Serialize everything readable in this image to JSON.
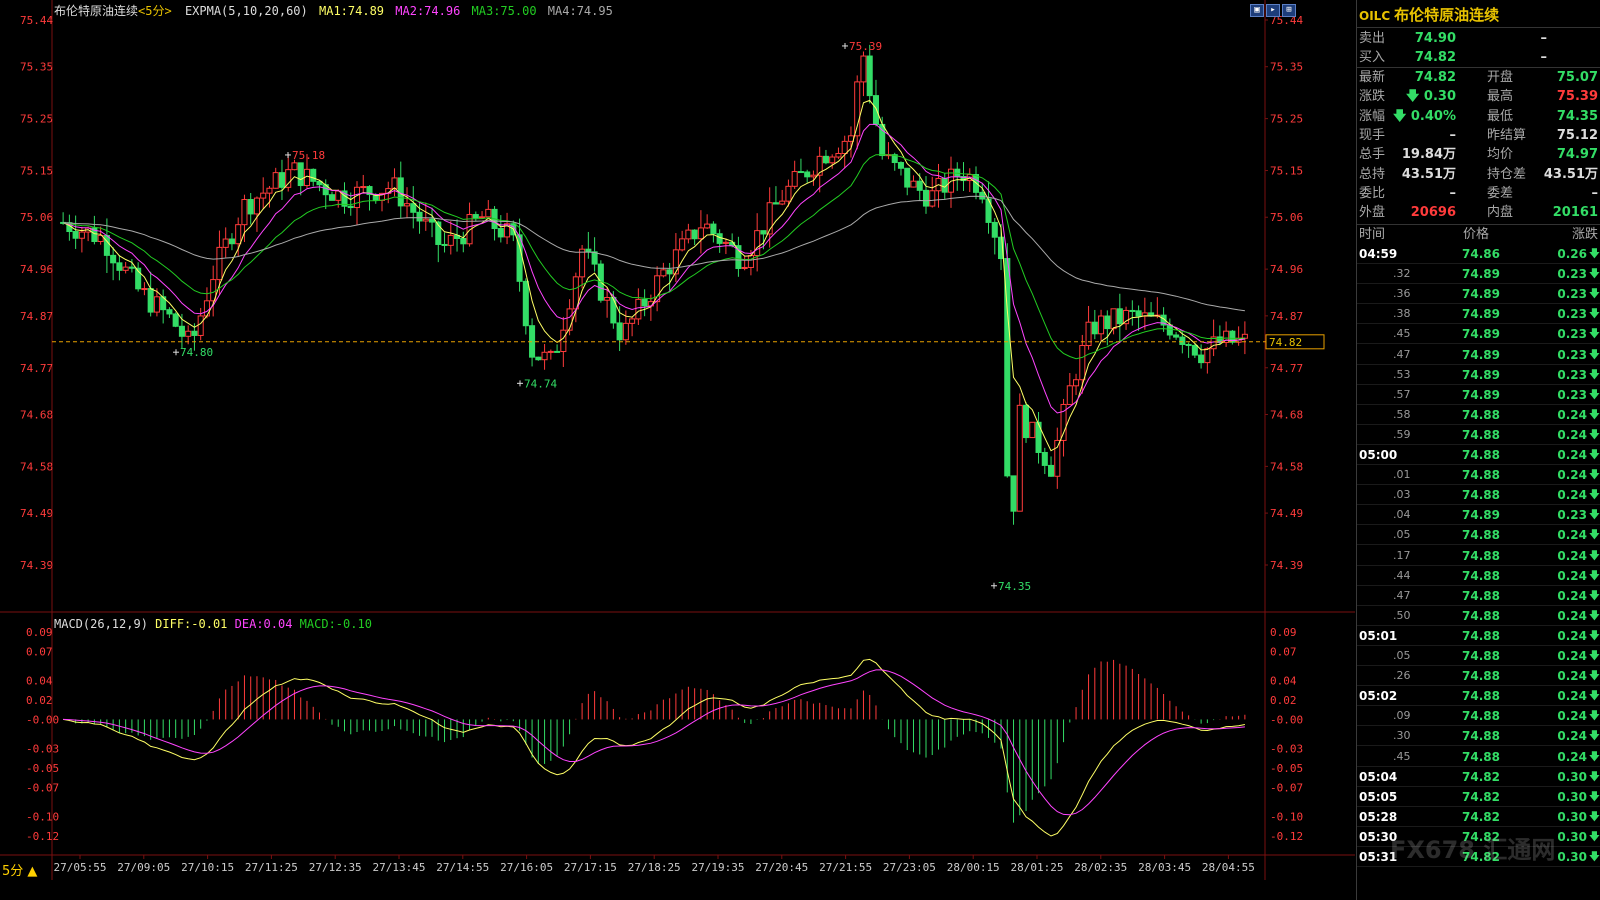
{
  "chart_header": {
    "instrument": "布伦特原油连续",
    "period_tag": "<5分>",
    "indicator": "EXPMA(5,10,20,60)",
    "ma1": "MA1:74.89",
    "ma2": "MA2:74.96",
    "ma3": "MA3:75.00",
    "ma4": "MA4:74.95"
  },
  "macd_header": {
    "name": "MACD(26,12,9)",
    "diff": "DIFF:-0.01",
    "dea": "DEA:0.04",
    "macd": "MACD:-0.10"
  },
  "price_axis_left": [
    "75.44",
    "75.35",
    "75.25",
    "75.15",
    "75.06",
    "74.96",
    "74.87",
    "74.77",
    "74.68",
    "74.58",
    "74.49",
    "74.39"
  ],
  "price_axis_right": [
    "75.44",
    "75.35",
    "75.25",
    "75.15",
    "75.06",
    "74.96",
    "74.87",
    "74.77",
    "74.68",
    "74.58",
    "74.49",
    "74.39"
  ],
  "macd_axis": [
    "0.09",
    "0.07",
    "0.04",
    "0.02",
    "-0.00",
    "-0.03",
    "-0.05",
    "-0.07",
    "-0.10",
    "-0.12"
  ],
  "time_axis": [
    "27/05:55",
    "27/09:05",
    "27/10:15",
    "27/11:25",
    "27/12:35",
    "27/13:45",
    "27/14:55",
    "27/16:05",
    "27/17:15",
    "27/18:25",
    "27/19:35",
    "27/20:45",
    "27/21:55",
    "27/23:05",
    "28/00:15",
    "28/01:25",
    "28/02:35",
    "28/03:45",
    "28/04:55"
  ],
  "annotations": {
    "high": "75.39",
    "peak1": "75.18",
    "low1": "74.80",
    "low2": "74.74",
    "low3": "74.35",
    "last_price": "74.82"
  },
  "period_button": "5分 ▲",
  "toolbar": [
    "▣",
    "▸",
    "⊞"
  ],
  "quote_panel": {
    "code": "OILC",
    "name": "布伦特原油连续",
    "sell_label": "卖出",
    "sell_value": "74.90",
    "sell_vol": "–",
    "buy_label": "买入",
    "buy_value": "74.82",
    "buy_vol": "–",
    "rows": [
      {
        "l1": "最新",
        "v1": "74.82",
        "c1": "#33dd66",
        "l2": "开盘",
        "v2": "75.07",
        "c2": "#33dd66"
      },
      {
        "l1": "涨跌",
        "v1": "🡇 0.30",
        "c1": "#33dd66",
        "l2": "最高",
        "v2": "75.39",
        "c2": "#ff3b3b"
      },
      {
        "l1": "涨幅",
        "v1": "🡇 0.40%",
        "c1": "#33dd66",
        "l2": "最低",
        "v2": "74.35",
        "c2": "#33dd66"
      },
      {
        "l1": "现手",
        "v1": "–",
        "c1": "#dddddd",
        "l2": "昨结算",
        "v2": "75.12",
        "c2": "#dddddd"
      },
      {
        "l1": "总手",
        "v1": "19.84万",
        "c1": "#dddddd",
        "l2": "均价",
        "v2": "74.97",
        "c2": "#33dd66"
      },
      {
        "l1": "总持",
        "v1": "43.51万",
        "c1": "#dddddd",
        "l2": "持仓差",
        "v2": "43.51万",
        "c2": "#dddddd"
      },
      {
        "l1": "委比",
        "v1": "–",
        "c1": "#dddddd",
        "l2": "委差",
        "v2": "–",
        "c2": "#dddddd"
      },
      {
        "l1": "外盘",
        "v1": "20696",
        "c1": "#ff3b3b",
        "l2": "内盘",
        "v2": "20161",
        "c2": "#33dd66"
      }
    ],
    "tick_header": {
      "time": "时间",
      "price": "价格",
      "change": "涨跌"
    },
    "ticks": [
      {
        "t": "04:59",
        "big": true,
        "p": "74.86",
        "c": "0.26"
      },
      {
        "t": ".32",
        "big": false,
        "p": "74.89",
        "c": "0.23"
      },
      {
        "t": ".36",
        "big": false,
        "p": "74.89",
        "c": "0.23"
      },
      {
        "t": ".38",
        "big": false,
        "p": "74.89",
        "c": "0.23"
      },
      {
        "t": ".45",
        "big": false,
        "p": "74.89",
        "c": "0.23"
      },
      {
        "t": ".47",
        "big": false,
        "p": "74.89",
        "c": "0.23"
      },
      {
        "t": ".53",
        "big": false,
        "p": "74.89",
        "c": "0.23"
      },
      {
        "t": ".57",
        "big": false,
        "p": "74.89",
        "c": "0.23"
      },
      {
        "t": ".58",
        "big": false,
        "p": "74.88",
        "c": "0.24"
      },
      {
        "t": ".59",
        "big": false,
        "p": "74.88",
        "c": "0.24"
      },
      {
        "t": "05:00",
        "big": true,
        "p": "74.88",
        "c": "0.24"
      },
      {
        "t": ".01",
        "big": false,
        "p": "74.88",
        "c": "0.24"
      },
      {
        "t": ".03",
        "big": false,
        "p": "74.88",
        "c": "0.24"
      },
      {
        "t": ".04",
        "big": false,
        "p": "74.89",
        "c": "0.23"
      },
      {
        "t": ".05",
        "big": false,
        "p": "74.88",
        "c": "0.24"
      },
      {
        "t": ".17",
        "big": false,
        "p": "74.88",
        "c": "0.24"
      },
      {
        "t": ".44",
        "big": false,
        "p": "74.88",
        "c": "0.24"
      },
      {
        "t": ".47",
        "big": false,
        "p": "74.88",
        "c": "0.24"
      },
      {
        "t": ".50",
        "big": false,
        "p": "74.88",
        "c": "0.24"
      },
      {
        "t": "05:01",
        "big": true,
        "p": "74.88",
        "c": "0.24"
      },
      {
        "t": ".05",
        "big": false,
        "p": "74.88",
        "c": "0.24"
      },
      {
        "t": ".26",
        "big": false,
        "p": "74.88",
        "c": "0.24"
      },
      {
        "t": "05:02",
        "big": true,
        "p": "74.88",
        "c": "0.24"
      },
      {
        "t": ".09",
        "big": false,
        "p": "74.88",
        "c": "0.24"
      },
      {
        "t": ".30",
        "big": false,
        "p": "74.88",
        "c": "0.24"
      },
      {
        "t": ".45",
        "big": false,
        "p": "74.88",
        "c": "0.24"
      },
      {
        "t": "05:04",
        "big": true,
        "p": "74.82",
        "c": "0.30"
      },
      {
        "t": "05:05",
        "big": true,
        "p": "74.82",
        "c": "0.30"
      },
      {
        "t": "05:28",
        "big": true,
        "p": "74.82",
        "c": "0.30"
      },
      {
        "t": "05:30",
        "big": true,
        "p": "74.82",
        "c": "0.30"
      },
      {
        "t": "05:31",
        "big": true,
        "p": "74.82",
        "c": "0.30"
      }
    ]
  },
  "watermark": "FX678 汇通网",
  "colors": {
    "up": "#ff3b3b",
    "down": "#33dd66",
    "ma1": "#ffff66",
    "ma2": "#ff44ff",
    "ma3": "#22cc22",
    "ma4": "#aaaaaa",
    "axis": "#ff3b3b"
  },
  "chart_data": {
    "type": "candlestick",
    "ylim": [
      74.35,
      75.44
    ],
    "key_points": [
      {
        "x": "27/05:55",
        "y": 75.05
      },
      {
        "x": "27/10:15",
        "y": 74.8
      },
      {
        "x": "27/11:25",
        "y": 75.18
      },
      {
        "x": "27/16:05",
        "y": 74.74
      },
      {
        "x": "27/21:55",
        "y": 75.39
      },
      {
        "x": "28/00:15",
        "y": 74.35
      },
      {
        "x": "28/04:55",
        "y": 74.82
      }
    ]
  }
}
